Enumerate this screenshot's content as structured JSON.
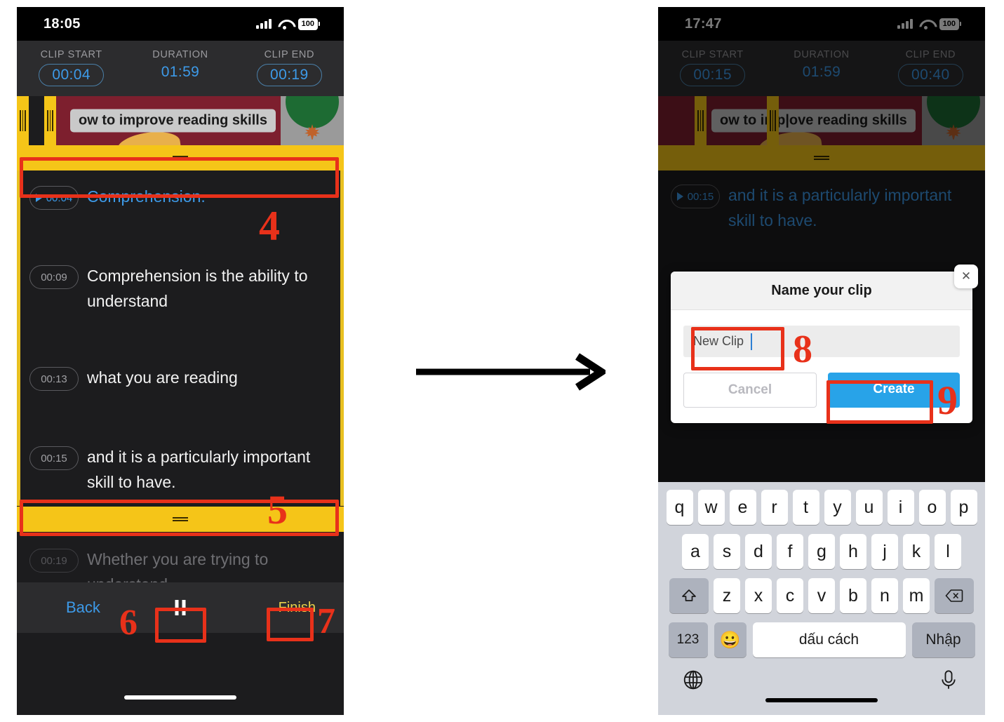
{
  "left_phone": {
    "status": {
      "time": "18:05",
      "battery": "100",
      "signal_icon": "cellular-signal-icon",
      "wifi_icon": "wifi-icon",
      "battery_icon": "battery-icon"
    },
    "clip_header": {
      "start_label": "CLIP START",
      "start_value": "00:04",
      "duration_label": "DURATION",
      "duration_value": "01:59",
      "end_label": "CLIP END",
      "end_value": "00:19"
    },
    "banner": {
      "title": "ow to improve reading skills"
    },
    "transcript": [
      {
        "time": "00:04",
        "text": "Comprehension.",
        "state": "active",
        "has_play": true
      },
      {
        "time": "00:09",
        "text": "Comprehension is the ability to understand",
        "state": "normal",
        "has_play": false
      },
      {
        "time": "00:13",
        "text": "what you are reading",
        "state": "normal",
        "has_play": false
      },
      {
        "time": "00:15",
        "text": "and it is a particularly important skill to have.",
        "state": "normal",
        "has_play": false
      },
      {
        "time": "00:19",
        "text": "Whether you are trying to understand",
        "state": "dim",
        "has_play": false
      }
    ],
    "bottom_bar": {
      "back_label": "Back",
      "pause_icon": "pause-icon",
      "finish_label": "Finish"
    }
  },
  "right_phone": {
    "status": {
      "time": "17:47",
      "battery": "100"
    },
    "clip_header": {
      "start_label": "CLIP START",
      "start_value": "00:15",
      "duration_label": "DURATION",
      "duration_value": "01:59",
      "end_label": "CLIP END",
      "end_value": "00:40"
    },
    "banner": {
      "title": "ow to imp|ove reading skills"
    },
    "transcript": [
      {
        "time": "00:15",
        "text": "and it is a particularly important skill to have.",
        "state": "active",
        "has_play": true
      }
    ],
    "modal": {
      "title": "Name your clip",
      "close_icon": "close-icon",
      "input_value": "New Clip",
      "input_placeholder": "New Clip",
      "cancel_label": "Cancel",
      "create_label": "Create"
    },
    "keyboard": {
      "row1": [
        "q",
        "w",
        "e",
        "r",
        "t",
        "y",
        "u",
        "i",
        "o",
        "p"
      ],
      "row2": [
        "a",
        "s",
        "d",
        "f",
        "g",
        "h",
        "j",
        "k",
        "l"
      ],
      "row3_shift_icon": "shift-icon",
      "row3": [
        "z",
        "x",
        "c",
        "v",
        "b",
        "n",
        "m"
      ],
      "row3_delete_icon": "delete-icon",
      "row4_num_label": "123",
      "row4_emoji_icon": "emoji-icon",
      "row4_space_label": "dấu cách",
      "row4_enter_label": "Nhập",
      "globe_icon": "globe-icon",
      "mic_icon": "microphone-icon"
    }
  },
  "annotations": {
    "numbers": [
      "4",
      "5",
      "6",
      "7",
      "8",
      "9"
    ],
    "arrow_icon": "right-arrow-icon",
    "highlight_color": "#e8311a"
  },
  "colors": {
    "accent_blue": "#3d9ae8",
    "handle_yellow": "#f5c518",
    "finish_yellow": "#e8d14a",
    "create_blue": "#28a3e8",
    "annotation_red": "#e8311a"
  }
}
